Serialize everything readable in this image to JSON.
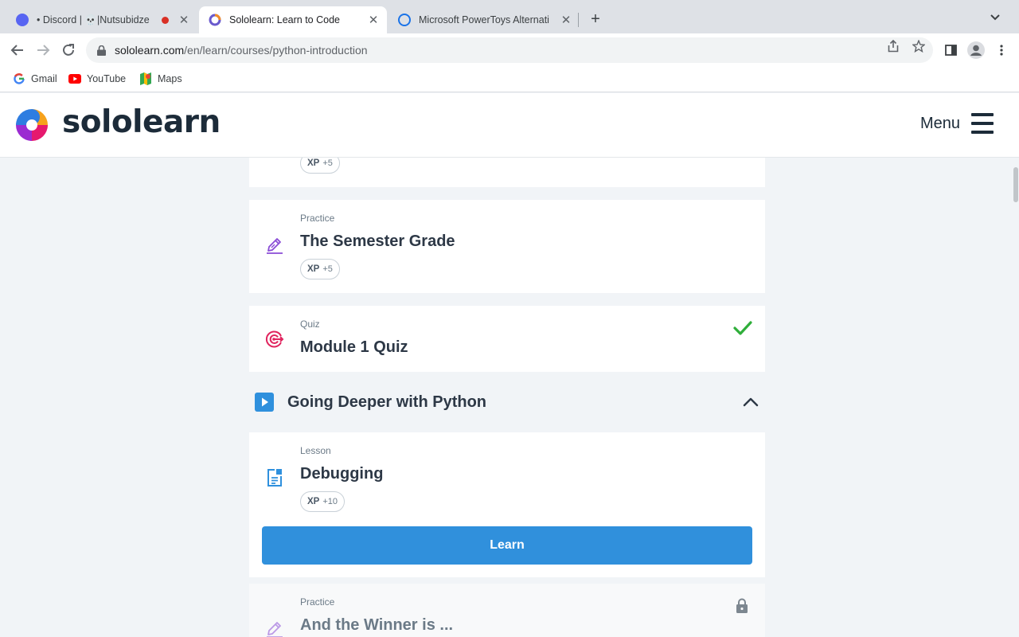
{
  "browser": {
    "tabs": [
      {
        "title": "• Discord | 💀|Nutsubidze",
        "active": false
      },
      {
        "title": "Sololearn: Learn to Code",
        "active": true
      },
      {
        "title": "Microsoft PowerToys Alternati",
        "active": false
      }
    ],
    "url_host": "sololearn.com",
    "url_path": "/en/learn/courses/python-introduction",
    "bookmarks": [
      {
        "label": "Gmail",
        "icon": "google-icon"
      },
      {
        "label": "YouTube",
        "icon": "youtube-icon"
      },
      {
        "label": "Maps",
        "icon": "maps-icon"
      }
    ]
  },
  "site": {
    "logo_text": "sololearn",
    "menu_label": "Menu"
  },
  "cards": {
    "prev_card": {
      "xp_label": "XP",
      "xp_value": "+5"
    },
    "semester": {
      "kind": "Practice",
      "title": "The Semester Grade",
      "xp_label": "XP",
      "xp_value": "+5",
      "icon": "practice-pencil-icon"
    },
    "quiz": {
      "kind": "Quiz",
      "title": "Module 1 Quiz",
      "icon": "target-icon",
      "completed": true
    },
    "section": {
      "title": "Going Deeper with Python",
      "expanded": true
    },
    "debugging": {
      "kind": "Lesson",
      "title": "Debugging",
      "xp_label": "XP",
      "xp_value": "+10",
      "button": "Learn",
      "icon": "lesson-document-icon"
    },
    "winner": {
      "kind": "Practice",
      "title": "And the Winner is ...",
      "locked": true,
      "icon": "practice-pencil-icon"
    }
  },
  "colors": {
    "accent": "#3090dc",
    "check": "#2fae3a",
    "quiz_icon": "#e0245e",
    "practice_icon": "#8a4cd6",
    "lesson_icon": "#2f90dd"
  }
}
